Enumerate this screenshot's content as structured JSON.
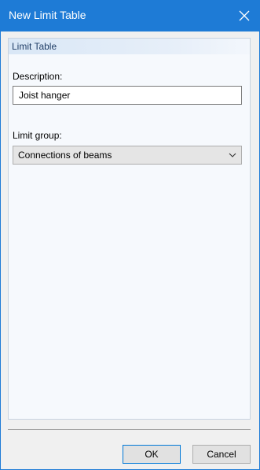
{
  "window": {
    "title": "New Limit Table"
  },
  "group": {
    "header": "Limit Table"
  },
  "description": {
    "label": "Description:",
    "value": "Joist hanger"
  },
  "limit_group": {
    "label": "Limit group:",
    "selected": "Connections of beams"
  },
  "buttons": {
    "ok": "OK",
    "cancel": "Cancel"
  },
  "icons": {
    "close": "close-icon",
    "dropdown": "chevron-down-icon"
  },
  "colors": {
    "titlebar": "#1e7bd6",
    "group_header": "#d9e7f6"
  }
}
